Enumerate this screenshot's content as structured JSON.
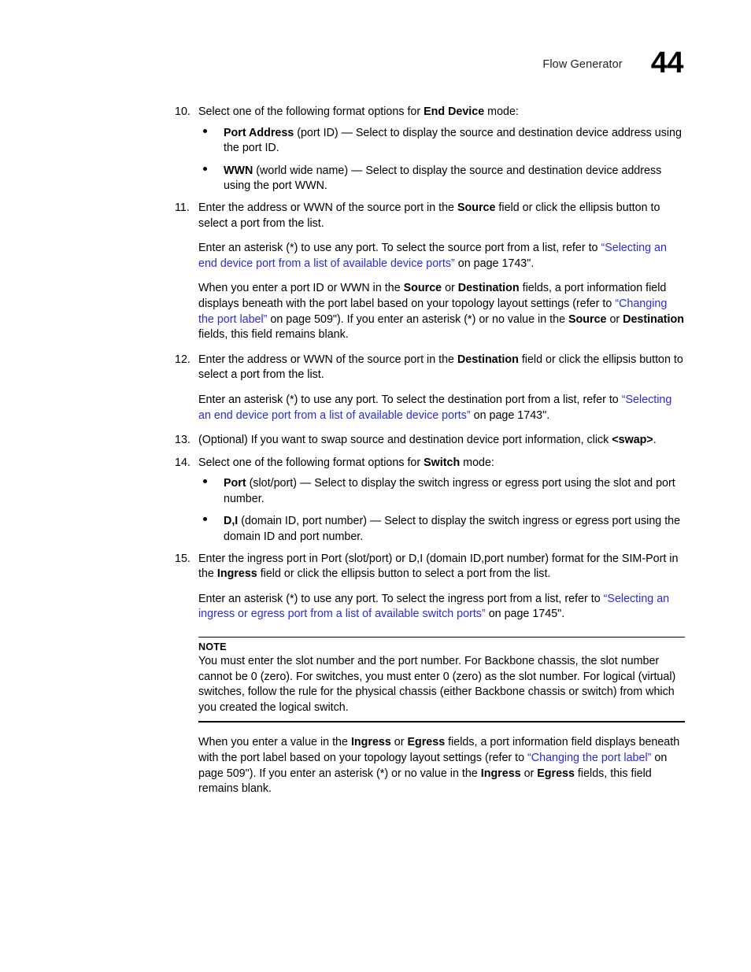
{
  "header": {
    "title": "Flow Generator",
    "folio": "44"
  },
  "steps": [
    {
      "number": "10.",
      "text_before": "Select one of the following format options for ",
      "bold": "End Device",
      "text_after": " mode:",
      "bullets": [
        {
          "bold": "Port Address",
          "text": " (port ID) — Select to display the source and destination device address using the port ID."
        },
        {
          "bold": "WWN",
          "text": " (world wide name) — Select to display the source and destination device address using the port WWN."
        }
      ]
    },
    {
      "number": "11.",
      "text_before": "Enter the address or WWN of the source port in the ",
      "bold": "Source",
      "text_after": " field or click the ellipsis button to select a port from the list."
    },
    {
      "number": "12.",
      "text_before": "Enter the address or WWN of the source port in the ",
      "bold": "Destination",
      "text_after": " field or click the ellipsis button to select a port from the list."
    },
    {
      "number": "13.",
      "text_before": "(Optional) If you want to swap source and destination device port information, click ",
      "bold": "<swap>",
      "text_after": "."
    },
    {
      "number": "14.",
      "text_before": "Select one of the following format options for ",
      "bold": "Switch",
      "text_after": " mode:",
      "bullets": [
        {
          "bold": "Port",
          "text": " (slot/port) — Select to display the switch ingress or egress port using the slot and port number."
        },
        {
          "bold": "D,I",
          "text": " (domain ID, port number) — Select to display the switch ingress or egress port using the domain ID and port number."
        }
      ]
    },
    {
      "number": "15.",
      "text_before": "Enter the ingress port in Port (slot/port) or D,I (domain ID,port number) format for the SIM-Port in the ",
      "bold": "Ingress",
      "text_after": " field or click the ellipsis button to select a port from the list."
    }
  ],
  "paragraphs": {
    "step11_note": {
      "lead": "Enter an asterisk (*) to use any port. To select the source port from a list, refer to ",
      "link": "“Selecting an end device port from a list of available device ports”",
      "tail": " on page 1743\"."
    },
    "port_info_source": {
      "p1": "When you enter a port ID or WWN in the ",
      "b1": "Source",
      "p2": " or ",
      "b2": "Destination",
      "p3": " fields, a port information field displays beneath with the port label based on your topology layout settings (refer to ",
      "link": "“Changing the port label”",
      "p4": " on page 509\"). If you enter an asterisk (*) or no value in the ",
      "b3": "Source",
      "p5": " or ",
      "b4": "Destination",
      "p6": " fields, this field remains blank."
    },
    "step12_note": {
      "lead": "Enter an asterisk (*) to use any port. To select the destination port from a list, refer to ",
      "link": "“Selecting an end device port from a list of available device ports”",
      "tail": " on page 1743\"."
    },
    "step15_note": {
      "lead": "Enter an asterisk (*) to use any port. To select the ingress port from a list, refer to ",
      "link": "“Selecting an ingress or egress port from a list of available switch ports”",
      "tail": " on page 1745\"."
    },
    "port_info_ingress": {
      "p1": "When you enter a value in the ",
      "b1": "Ingress",
      "p2": " or ",
      "b2": "Egress",
      "p3": " fields, a port information field displays beneath with the port label based on your topology layout settings (refer to ",
      "link": "“Changing the port label”",
      "p4": " on page 509\"). If you enter an asterisk (*) or no value in the ",
      "b3": "Ingress",
      "p5": " or ",
      "b4": "Egress",
      "p6": " fields, this field remains blank."
    }
  },
  "note": {
    "label": "NOTE",
    "text": "You must enter the slot number and the port number. For Backbone chassis, the slot number cannot be 0 (zero). For switches, you must enter 0 (zero) as the slot number. For logical (virtual) switches, follow the rule for the physical chassis (either Backbone chassis or switch) from which you created the logical switch."
  },
  "colors": {
    "link": "#2b2bd9",
    "text": "#000000",
    "background": "#ffffff"
  }
}
